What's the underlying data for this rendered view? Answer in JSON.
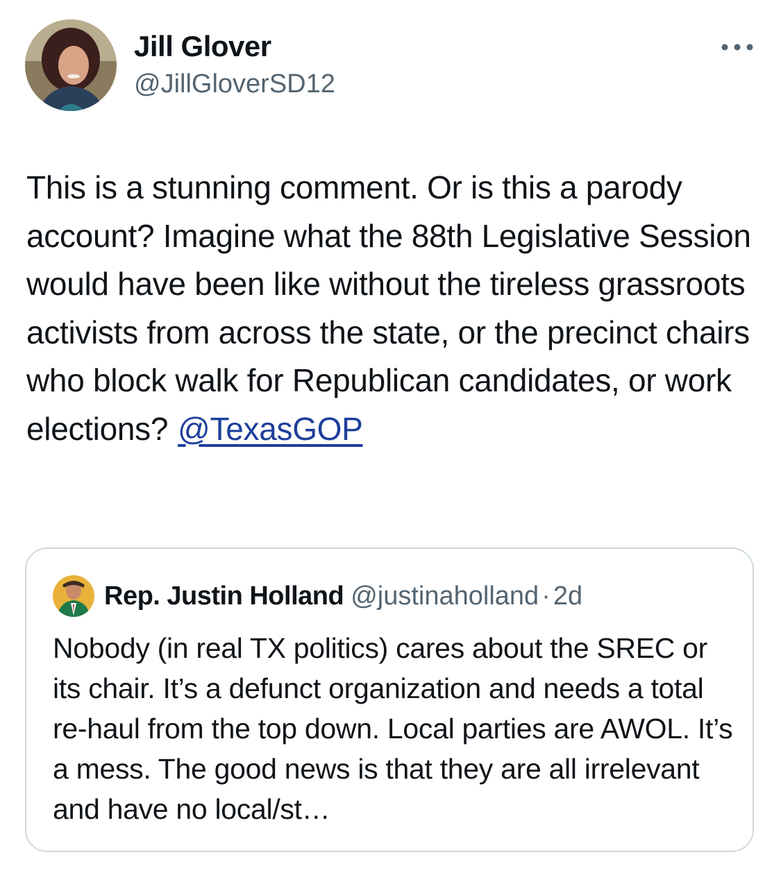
{
  "author": {
    "display_name": "Jill Glover",
    "handle": "@JillGloverSD12",
    "avatar_icon": "profile-photo"
  },
  "more_icon": "more-horizontal-icon",
  "tweet": {
    "text": "This is a stunning comment. Or is this a parody account? Imagine what the 88th Legislative Session would have been like without the tireless grassroots activists from across the state, or the precinct chairs who block walk for Republican candidates, or work elections?",
    "mention": "@TexasGOP"
  },
  "quoted_tweet": {
    "display_name": "Rep. Justin Holland",
    "handle": "@justinaholland",
    "separator": "·",
    "time": "2d",
    "text": "Nobody (in real TX politics) cares about the SREC or its chair. It’s a defunct organization and needs a total re-haul from the top down. Local parties are AWOL. It’s a mess. The good news is that they are all irrelevant and have no local/st…"
  },
  "colors": {
    "text_primary": "#0f1419",
    "text_secondary": "#536471",
    "link": "#1d3f9b",
    "border": "#cfd9de"
  }
}
